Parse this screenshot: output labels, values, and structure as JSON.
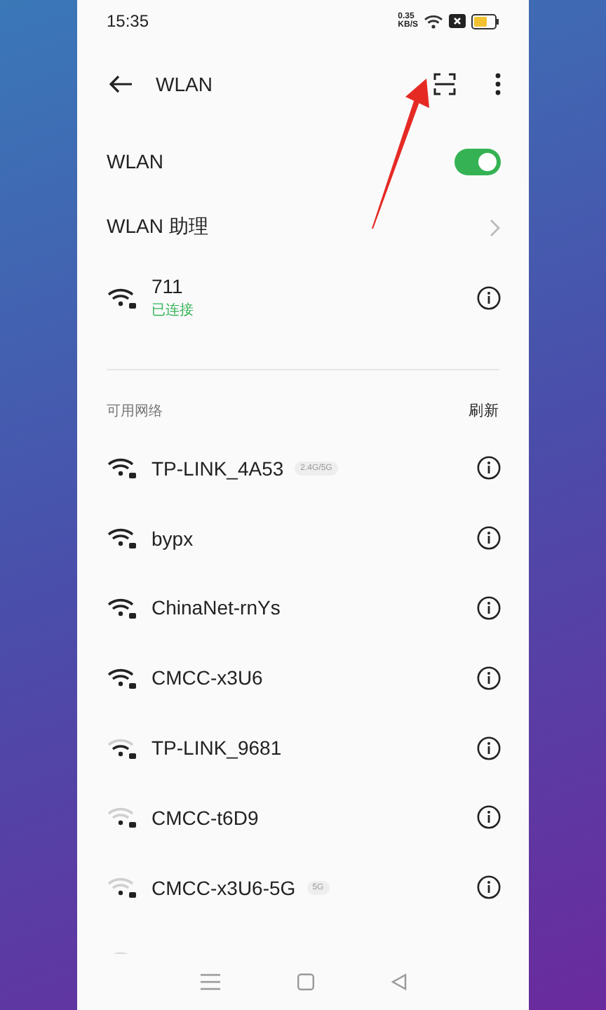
{
  "status_bar": {
    "time": "15:35",
    "speed": "0.35",
    "speed_unit": "KB/S"
  },
  "header": {
    "title": "WLAN"
  },
  "wlan": {
    "label": "WLAN",
    "on": true
  },
  "assistant": {
    "label": "WLAN 助理"
  },
  "connected": {
    "name": "711",
    "status": "已连接",
    "kind": "strong"
  },
  "available": {
    "title": "可用网络",
    "refresh": "刷新"
  },
  "networks": [
    {
      "name": "TP-LINK_4A53",
      "band": "2.4G/5G",
      "kind": "strong"
    },
    {
      "name": "bypx",
      "kind": "strong"
    },
    {
      "name": "ChinaNet-rnYs",
      "kind": "strong"
    },
    {
      "name": "CMCC-x3U6",
      "kind": "strong"
    },
    {
      "name": "TP-LINK_9681",
      "kind": "medium"
    },
    {
      "name": "CMCC-t6D9",
      "kind": "weak"
    },
    {
      "name": "CMCC-x3U6-5G",
      "band": "5G",
      "kind": "weak"
    }
  ]
}
